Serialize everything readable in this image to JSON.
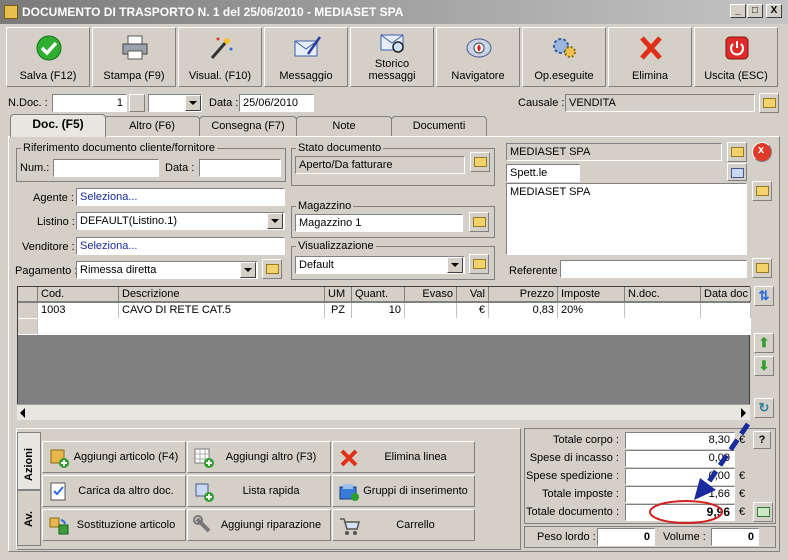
{
  "window": {
    "title": "DOCUMENTO DI TRASPORTO N. 1  del 25/06/2010 - MEDIASET SPA",
    "min": "_",
    "max": "□",
    "close": "X"
  },
  "toolbar": [
    {
      "label": "Salva (F12)",
      "icon": "save-icon"
    },
    {
      "label": "Stampa (F9)",
      "icon": "printer-icon"
    },
    {
      "label": "Visual. (F10)",
      "icon": "magic-wand-icon"
    },
    {
      "label": "Messaggio",
      "icon": "envelope-pen-icon"
    },
    {
      "label": "Storico\nmessaggi",
      "icon": "envelope-search-icon"
    },
    {
      "label": "Navigatore",
      "icon": "compass-icon"
    },
    {
      "label": "Op.eseguite",
      "icon": "gears-search-icon"
    },
    {
      "label": "Elimina",
      "icon": "delete-x-icon"
    },
    {
      "label": "Uscita (ESC)",
      "icon": "power-icon"
    }
  ],
  "header": {
    "ndoc_label": "N.Doc. :",
    "ndoc_value": "1",
    "data_label": "Data :",
    "data_value": "25/06/2010",
    "causale_label": "Causale :",
    "causale_value": "VENDITA"
  },
  "tabs": [
    "Doc. (F5)",
    "Altro (F6)",
    "Consegna (F7)",
    "Note",
    "Documenti"
  ],
  "doc": {
    "rif_legend": "Riferimento documento cliente/fornitore",
    "num_label": "Num.:",
    "num_value": "",
    "data_label": "Data :",
    "data_value": "",
    "agente_label": "Agente :",
    "agente_value": "Seleziona...",
    "listino_label": "Listino :",
    "listino_value": "DEFAULT(Listino.1)",
    "venditore_label": "Venditore :",
    "venditore_value": "Seleziona...",
    "pagamento_label": "Pagamento :",
    "pagamento_value": "Rimessa diretta",
    "stato_legend": "Stato documento",
    "stato_value": "Aperto/Da fatturare",
    "magazzino_legend": "Magazzino",
    "magazzino_value": "Magazzino 1",
    "visual_legend": "Visualizzazione",
    "visual_value": "Default",
    "cliente_name": "MEDIASET SPA",
    "cliente_title": "Spett.le",
    "cliente_address": "MEDIASET SPA",
    "referente_label": "Referente",
    "referente_value": ""
  },
  "grid": {
    "columns": [
      "Cod.",
      "Descrizione",
      "UM",
      "Quant.",
      "Evaso",
      "Val",
      "Prezzo",
      "Imposte",
      "N.doc.",
      "Data doc"
    ],
    "rows": [
      [
        "1003",
        "CAVO DI RETE CAT.5",
        "PZ",
        "10",
        "",
        "€",
        "0,83",
        "20%",
        "",
        ""
      ]
    ]
  },
  "actions": {
    "tab_azioni": "Azioni",
    "tab_av": "Av.",
    "buttons": [
      {
        "label": "Aggiungi articolo (F4)",
        "icon": "add-box-icon"
      },
      {
        "label": "Aggiungi altro (F3)",
        "icon": "add-grid-icon"
      },
      {
        "label": "Elimina linea",
        "icon": "delete-x-icon"
      },
      {
        "label": "Carica da altro doc.",
        "icon": "load-doc-icon"
      },
      {
        "label": "Lista rapida",
        "icon": "quick-list-icon"
      },
      {
        "label": "Gruppi di inserimento",
        "icon": "group-insert-icon"
      },
      {
        "label": "Sostituzione articolo",
        "icon": "replace-icon"
      },
      {
        "label": "Aggiungi riparazione",
        "icon": "wrench-icon"
      },
      {
        "label": "Carrello",
        "icon": "cart-icon"
      }
    ]
  },
  "totals": [
    {
      "label": "Totale corpo :",
      "value": "8,30"
    },
    {
      "label": "Spese di incasso :",
      "value": "0,00"
    },
    {
      "label": "Spese spedizione :",
      "value": "0,00"
    },
    {
      "label": "Totale imposte :",
      "value": "1,66"
    },
    {
      "label": "Totale documento :",
      "value": "9,96"
    }
  ],
  "currency": "€",
  "help": "?",
  "peso_label": "Peso lordo :",
  "peso_value": "0",
  "volume_label": "Volume :",
  "volume_value": "0",
  "colors": {
    "annotation_arrow": "#1a2b9e",
    "annotation_circle": "#d21f1f"
  }
}
